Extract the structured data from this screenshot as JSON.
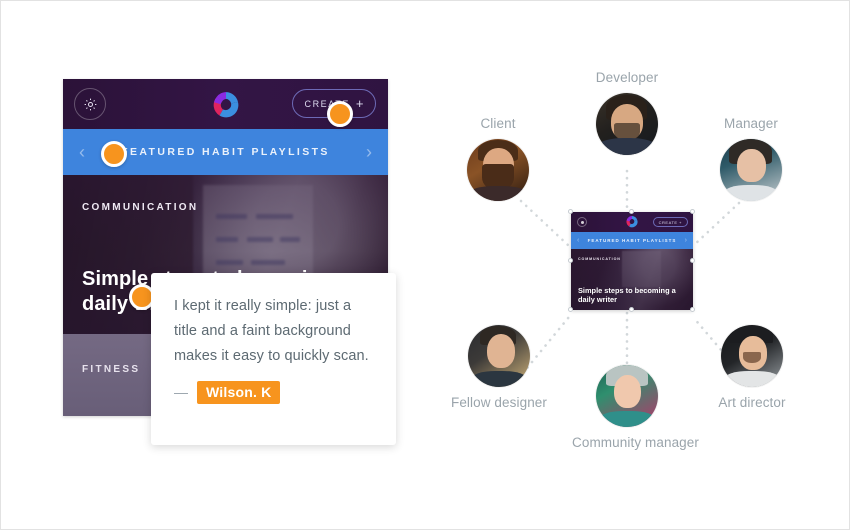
{
  "app_card": {
    "gear_icon": "gear-icon",
    "logo_icon": "app-logo-ring-icon",
    "create_label": "CREATE",
    "create_plus": "+",
    "nav_prev_icon": "chevron-left-icon",
    "nav_next_icon": "chevron-right-icon",
    "featured_label": "FEATURED HABIT PLAYLISTS",
    "hero_category": "COMMUNICATION",
    "hero_title": "Simple steps to becoming a daily writer",
    "panel2_category": "FITNESS"
  },
  "quote": {
    "text": "I kept it really simple: just a title and a faint background makes it easy to quickly scan.",
    "dash": "—",
    "author": "Wilson. K"
  },
  "mini_card": {
    "create_label": "CREATE +",
    "featured_label": "FEATURED HABIT PLAYLISTS",
    "hero_category": "COMMUNICATION",
    "hero_title": "Simple steps to becoming a daily writer"
  },
  "network": {
    "nodes": [
      {
        "id": "developer",
        "label": "Developer"
      },
      {
        "id": "client",
        "label": "Client"
      },
      {
        "id": "manager",
        "label": "Manager"
      },
      {
        "id": "fellow-designer",
        "label": "Fellow designer"
      },
      {
        "id": "community-manager",
        "label": "Community manager"
      },
      {
        "id": "art-director",
        "label": "Art director"
      }
    ]
  },
  "colors": {
    "accent_orange": "#f7941e",
    "banner_blue": "#3e84dd",
    "card_purple": "#2b1338",
    "label_gray": "#9aa4ab",
    "quote_text": "#5d6a72"
  }
}
